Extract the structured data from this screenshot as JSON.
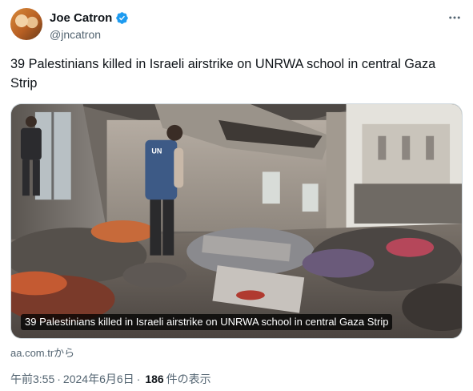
{
  "author": {
    "name": "Joe Catron",
    "handle": "@jncatron"
  },
  "tweet": {
    "text": "39 Palestinians killed in Israeli airstrike on UNRWA school in central Gaza Strip"
  },
  "media": {
    "caption": "39 Palestinians killed in Israeli airstrike on UNRWA school in central Gaza Strip",
    "vest_text": "UN",
    "source": "aa.com.trから"
  },
  "meta": {
    "time": "午前3:55",
    "separator": "·",
    "date": "2024年6月6日",
    "views_count": "186",
    "views_label": "件の表示"
  },
  "colors": {
    "verified": "#1d9bf0",
    "text_primary": "#0f1419",
    "text_secondary": "#536471"
  }
}
